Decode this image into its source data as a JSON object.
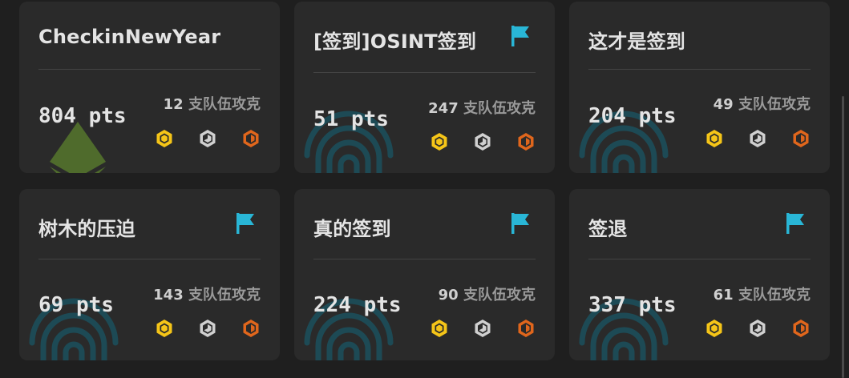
{
  "unit_label": "支队伍攻克",
  "colors": {
    "accent": "#29b6d6",
    "gold": "#f5c518",
    "silver": "#d0d0d0",
    "bronze": "#e0661c"
  },
  "challenges": [
    {
      "title": "CheckinNewYear",
      "points": "804 pts",
      "solves": "12",
      "flag": false
    },
    {
      "title": "[签到]OSINT签到",
      "points": "51 pts",
      "solves": "247",
      "flag": true
    },
    {
      "title": "这才是签到",
      "points": "204 pts",
      "solves": "49",
      "flag": false
    },
    {
      "title": "树木的压迫",
      "points": "69 pts",
      "solves": "143",
      "flag": true
    },
    {
      "title": "真的签到",
      "points": "224 pts",
      "solves": "90",
      "flag": true
    },
    {
      "title": "签退",
      "points": "337 pts",
      "solves": "61",
      "flag": true
    }
  ]
}
